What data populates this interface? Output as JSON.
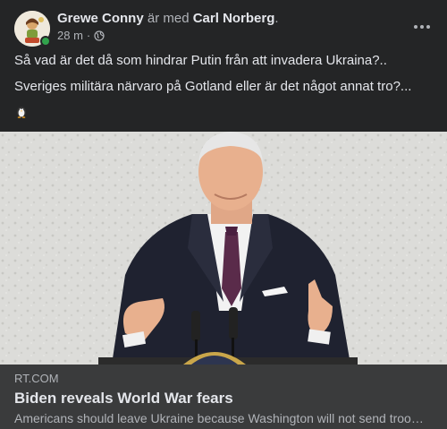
{
  "post": {
    "author": "Grewe Conny",
    "with_text": "är med",
    "tagged_person": "Carl Norberg",
    "tagged_suffix": ".",
    "timestamp": "28 m",
    "separator": "·",
    "audience_icon": "globe-icon",
    "more_icon": "more-horizontal-icon",
    "text_line_1": "Så vad är det då som hindrar Putin från att invadera Ukraina?..",
    "text_line_2": "Sveriges militära närvaro på Gotland eller är det något annat tro?...",
    "emoji_icon": "penguin-emoji-icon"
  },
  "link_preview": {
    "domain": "RT.COM",
    "title": "Biden reveals World War fears",
    "description": "Americans should leave Ukraine because Washington will not send troops to rescue them"
  },
  "colors": {
    "background": "#242526",
    "card": "#3a3b3c",
    "primary_text": "#e4e6eb",
    "secondary_text": "#b0b3b8",
    "online": "#31a24c"
  }
}
